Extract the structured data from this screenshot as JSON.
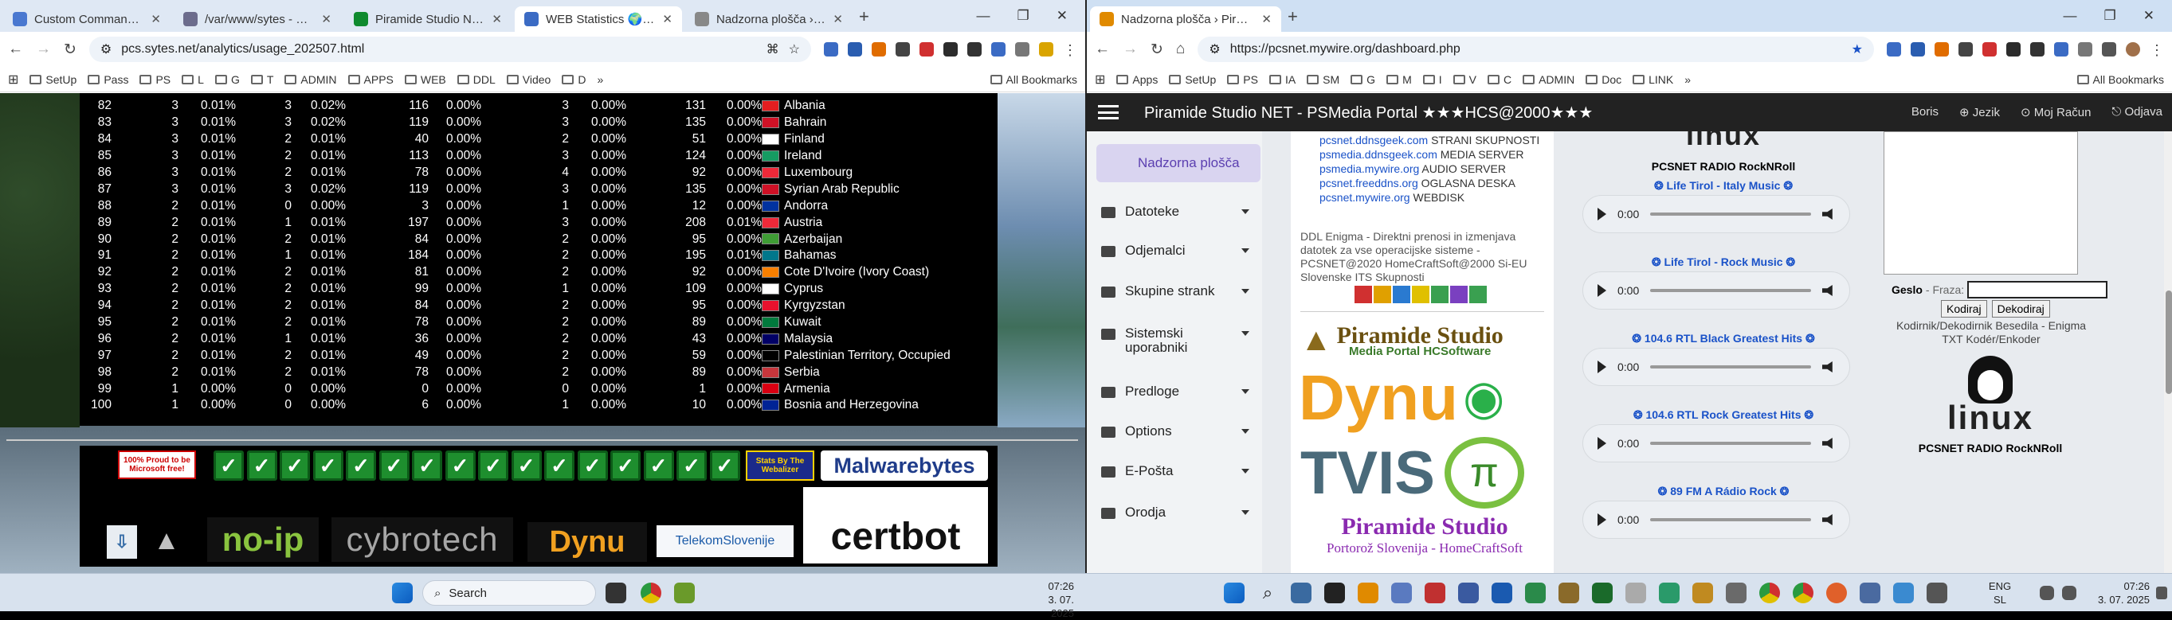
{
  "left": {
    "tabs": [
      {
        "title": "Custom Commands/Execute",
        "color": "#4a78d0"
      },
      {
        "title": "/var/www/sytes - File Manag",
        "color": "#6c6c8c"
      },
      {
        "title": "Piramide Studio NET 🌍 WEB",
        "color": "#0f8a2e"
      },
      {
        "title": "WEB Statistics 🌍 VPN",
        "color": "#3b6bc4"
      },
      {
        "title": "Nadzorna plošča › Piramide",
        "color": "#888888"
      }
    ],
    "active_tab": 3,
    "url": "pcs.sytes.net/analytics/usage_202507.html",
    "bookmarks": [
      "SetUp",
      "Pass",
      "PS",
      "L",
      "G",
      "T",
      "ADMIN",
      "APPS",
      "WEB",
      "DDL",
      "Video",
      "D"
    ],
    "all_bookmarks": "All Bookmarks",
    "stats_rows": [
      [
        "82",
        "3",
        "0.01%",
        "3",
        "0.02%",
        "116",
        "0.00%",
        "3",
        "0.00%",
        "131",
        "0.00%",
        "Albania"
      ],
      [
        "83",
        "3",
        "0.01%",
        "3",
        "0.02%",
        "119",
        "0.00%",
        "3",
        "0.00%",
        "135",
        "0.00%",
        "Bahrain"
      ],
      [
        "84",
        "3",
        "0.01%",
        "2",
        "0.01%",
        "40",
        "0.00%",
        "2",
        "0.00%",
        "51",
        "0.00%",
        "Finland"
      ],
      [
        "85",
        "3",
        "0.01%",
        "2",
        "0.01%",
        "113",
        "0.00%",
        "3",
        "0.00%",
        "124",
        "0.00%",
        "Ireland"
      ],
      [
        "86",
        "3",
        "0.01%",
        "2",
        "0.01%",
        "78",
        "0.00%",
        "4",
        "0.00%",
        "92",
        "0.00%",
        "Luxembourg"
      ],
      [
        "87",
        "3",
        "0.01%",
        "3",
        "0.02%",
        "119",
        "0.00%",
        "3",
        "0.00%",
        "135",
        "0.00%",
        "Syrian Arab Republic"
      ],
      [
        "88",
        "2",
        "0.01%",
        "0",
        "0.00%",
        "3",
        "0.00%",
        "1",
        "0.00%",
        "12",
        "0.00%",
        "Andorra"
      ],
      [
        "89",
        "2",
        "0.01%",
        "1",
        "0.01%",
        "197",
        "0.00%",
        "3",
        "0.00%",
        "208",
        "0.01%",
        "Austria"
      ],
      [
        "90",
        "2",
        "0.01%",
        "2",
        "0.01%",
        "84",
        "0.00%",
        "2",
        "0.00%",
        "95",
        "0.00%",
        "Azerbaijan"
      ],
      [
        "91",
        "2",
        "0.01%",
        "1",
        "0.01%",
        "184",
        "0.00%",
        "2",
        "0.00%",
        "195",
        "0.01%",
        "Bahamas"
      ],
      [
        "92",
        "2",
        "0.01%",
        "2",
        "0.01%",
        "81",
        "0.00%",
        "2",
        "0.00%",
        "92",
        "0.00%",
        "Cote D'Ivoire (Ivory Coast)"
      ],
      [
        "93",
        "2",
        "0.01%",
        "2",
        "0.01%",
        "99",
        "0.00%",
        "1",
        "0.00%",
        "109",
        "0.00%",
        "Cyprus"
      ],
      [
        "94",
        "2",
        "0.01%",
        "2",
        "0.01%",
        "84",
        "0.00%",
        "2",
        "0.00%",
        "95",
        "0.00%",
        "Kyrgyzstan"
      ],
      [
        "95",
        "2",
        "0.01%",
        "2",
        "0.01%",
        "78",
        "0.00%",
        "2",
        "0.00%",
        "89",
        "0.00%",
        "Kuwait"
      ],
      [
        "96",
        "2",
        "0.01%",
        "1",
        "0.01%",
        "36",
        "0.00%",
        "2",
        "0.00%",
        "43",
        "0.00%",
        "Malaysia"
      ],
      [
        "97",
        "2",
        "0.01%",
        "2",
        "0.01%",
        "49",
        "0.00%",
        "2",
        "0.00%",
        "59",
        "0.00%",
        "Palestinian Territory, Occupied"
      ],
      [
        "98",
        "2",
        "0.01%",
        "2",
        "0.01%",
        "78",
        "0.00%",
        "2",
        "0.00%",
        "89",
        "0.00%",
        "Serbia"
      ],
      [
        "99",
        "1",
        "0.00%",
        "0",
        "0.00%",
        "0",
        "0.00%",
        "0",
        "0.00%",
        "1",
        "0.00%",
        "Armenia"
      ],
      [
        "100",
        "1",
        "0.00%",
        "0",
        "0.00%",
        "6",
        "0.00%",
        "1",
        "0.00%",
        "10",
        "0.00%",
        "Bosnia and Herzegovina"
      ]
    ],
    "badges": {
      "microsoft": "100% Proud to be Microsoft free!",
      "webalizer": "Stats By The Webalizer",
      "malwarebytes": "Malwarebytes",
      "noip": "no-ip",
      "cybrotech": "cybrotech",
      "dynu": "Dynu",
      "telekom": "TelekomSlovenije",
      "certbot": "certbot",
      "check_count": 16
    }
  },
  "right": {
    "tab_title": "Nadzorna plošča › Piramide St",
    "url": "https://pcsnet.mywire.org/dashboard.php",
    "bookmarks": [
      "Apps",
      "SetUp",
      "PS",
      "IA",
      "SM",
      "G",
      "M",
      "I",
      "V",
      "C",
      "ADMIN",
      "Doc",
      "LINK"
    ],
    "all_bookmarks": "All Bookmarks",
    "brand": "Piramide Studio NET - PSMedia Portal ★★★HCS@2000★★★",
    "nav_right": [
      "Boris",
      "Jezik",
      "Moj Račun",
      "Odjava"
    ],
    "sidebar_active": "Nadzorna plošča",
    "sidebar": [
      "Datoteke",
      "Odjemalci",
      "Skupine strank",
      "Sistemski uporabniki",
      "Predloge",
      "Options",
      "E-Pošta",
      "Orodja"
    ],
    "links": [
      {
        "host": "pcsnet.ddnsgeek.com",
        "label": "STRANI SKUPNOSTI"
      },
      {
        "host": "psmedia.ddnsgeek.com",
        "label": "MEDIA SERVER"
      },
      {
        "host": "psmedia.mywire.org",
        "label": "AUDIO SERVER"
      },
      {
        "host": "pcsnet.freeddns.org",
        "label": "OGLASNA DESKA"
      },
      {
        "host": "pcsnet.mywire.org",
        "label": "WEBDISK"
      }
    ],
    "ddl_text": "DDL Enigma - Direktni prenosi in izmenjava datotek za vse operacijske sisteme - PCSNET@2020 HomeCraftSoft@2000 Si-EU Slovenske ITS Skupnosti",
    "logo_piramide": "Piramide Studio",
    "logo_piramide_sub": "Media Portal HCSoftware",
    "logo_dynu": "Dynu",
    "logo_tvis": "TVIS",
    "logo_piramide2": "Piramide Studio",
    "logo_piramide2_sub": "Portorož Slovenija - HomeCraftSoft",
    "radio_title": "PCSNET RADIO RockNRoll",
    "linux_word": "linux",
    "stations": [
      "❂ Life Tirol - Italy Music ❂",
      "❂ Life Tirol - Rock Music ❂",
      "❂ 104.6 RTL Black Greatest Hits ❂",
      "❂ 104.6 RTL Rock Greatest Hits ❂",
      "❂ 89 FM A Rádio Rock ❂"
    ],
    "player_time": "0:00",
    "geslo_label": "Geslo",
    "fraza_label": "- Fraza:",
    "kodiraj": "Kodiraj",
    "dekodiraj": "Dekodiraj",
    "kodirnik_text": "Kodirnik/Dekodirnik Besedila - Enigma TXT Kodér/Enkoder",
    "kodirnik_bold": "TXT"
  },
  "taskbar_left": {
    "search": "Search",
    "time": "07:26",
    "date": "3. 07. 2025"
  },
  "taskbar_right": {
    "lang1": "ENG",
    "lang2": "SL",
    "time": "07:26",
    "date": "3. 07. 2025"
  }
}
